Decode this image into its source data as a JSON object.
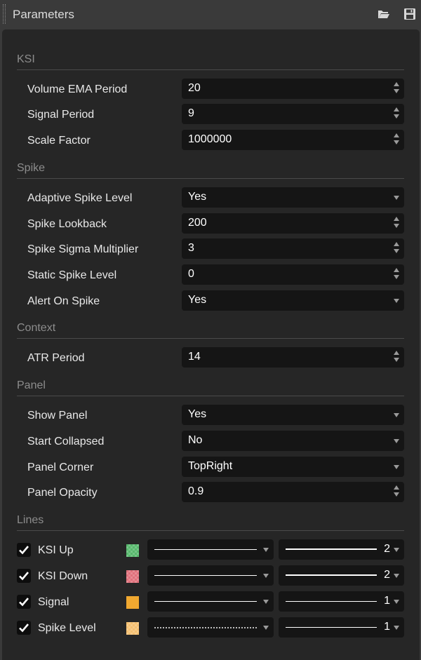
{
  "window": {
    "title": "Parameters",
    "open_icon": "folder-open-icon",
    "save_icon": "save-icon"
  },
  "sections": {
    "ksi": {
      "title": "KSI",
      "volume_ema_period": {
        "label": "Volume EMA Period",
        "value": "20"
      },
      "signal_period": {
        "label": "Signal Period",
        "value": "9"
      },
      "scale_factor": {
        "label": "Scale Factor",
        "value": "1000000"
      }
    },
    "spike": {
      "title": "Spike",
      "adaptive_spike_level": {
        "label": "Adaptive Spike Level",
        "value": "Yes"
      },
      "spike_lookback": {
        "label": "Spike Lookback",
        "value": "200"
      },
      "spike_sigma_multiplier": {
        "label": "Spike Sigma Multiplier",
        "value": "3"
      },
      "static_spike_level": {
        "label": "Static Spike Level",
        "value": "0"
      },
      "alert_on_spike": {
        "label": "Alert On Spike",
        "value": "Yes"
      }
    },
    "context": {
      "title": "Context",
      "atr_period": {
        "label": "ATR Period",
        "value": "14"
      }
    },
    "panel": {
      "title": "Panel",
      "show_panel": {
        "label": "Show Panel",
        "value": "Yes"
      },
      "start_collapsed": {
        "label": "Start Collapsed",
        "value": "No"
      },
      "panel_corner": {
        "label": "Panel Corner",
        "value": "TopRight"
      },
      "panel_opacity": {
        "label": "Panel Opacity",
        "value": "0.9"
      }
    },
    "lines": {
      "title": "Lines",
      "items": [
        {
          "label": "KSI Up",
          "checked": true,
          "color": "#57b86c",
          "style": "solid",
          "width": "2"
        },
        {
          "label": "KSI Down",
          "checked": true,
          "color": "#e0707b",
          "style": "solid",
          "width": "2"
        },
        {
          "label": "Signal",
          "checked": true,
          "color": "#f0a830",
          "style": "solid",
          "width": "1"
        },
        {
          "label": "Spike Level",
          "checked": true,
          "color": "#f5c070",
          "style": "dotted",
          "width": "1"
        }
      ]
    }
  },
  "colors": {
    "panel_bg": "#262626",
    "field_bg": "#151515",
    "section_text": "#8c8c8c"
  }
}
